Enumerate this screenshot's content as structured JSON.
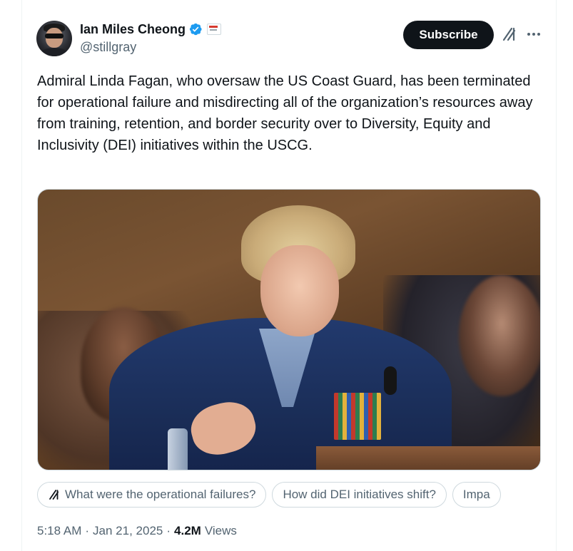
{
  "author": {
    "display_name": "Ian Miles Cheong",
    "handle": "@stillgray",
    "verified": true,
    "verified_color": "#1d9bf0"
  },
  "header_actions": {
    "subscribe_label": "Subscribe",
    "grok_icon": "grok-icon",
    "more_icon": "more-horizontal-icon"
  },
  "tweet": {
    "text": "Admiral Linda Fagan, who oversaw the US Coast Guard, has been terminated for operational failure and misdirecting all of the organization’s resources away from training, retention, and border security over to Diversity, Equity and Inclusivity (DEI) initiatives within the USCG."
  },
  "media": {
    "type": "photo"
  },
  "grok_suggestions": [
    {
      "label": "What were the operational failures?",
      "has_icon": true
    },
    {
      "label": "How did DEI initiatives shift?",
      "has_icon": false
    },
    {
      "label": "Impa",
      "has_icon": false
    }
  ],
  "meta": {
    "time": "5:18 AM",
    "date": "Jan 21, 2025",
    "separator": "·",
    "views_count": "4.2M",
    "views_label": "Views"
  },
  "colors": {
    "text_primary": "#0f1419",
    "text_secondary": "#536471",
    "border": "#cfd9de",
    "button_bg": "#0f1419"
  }
}
